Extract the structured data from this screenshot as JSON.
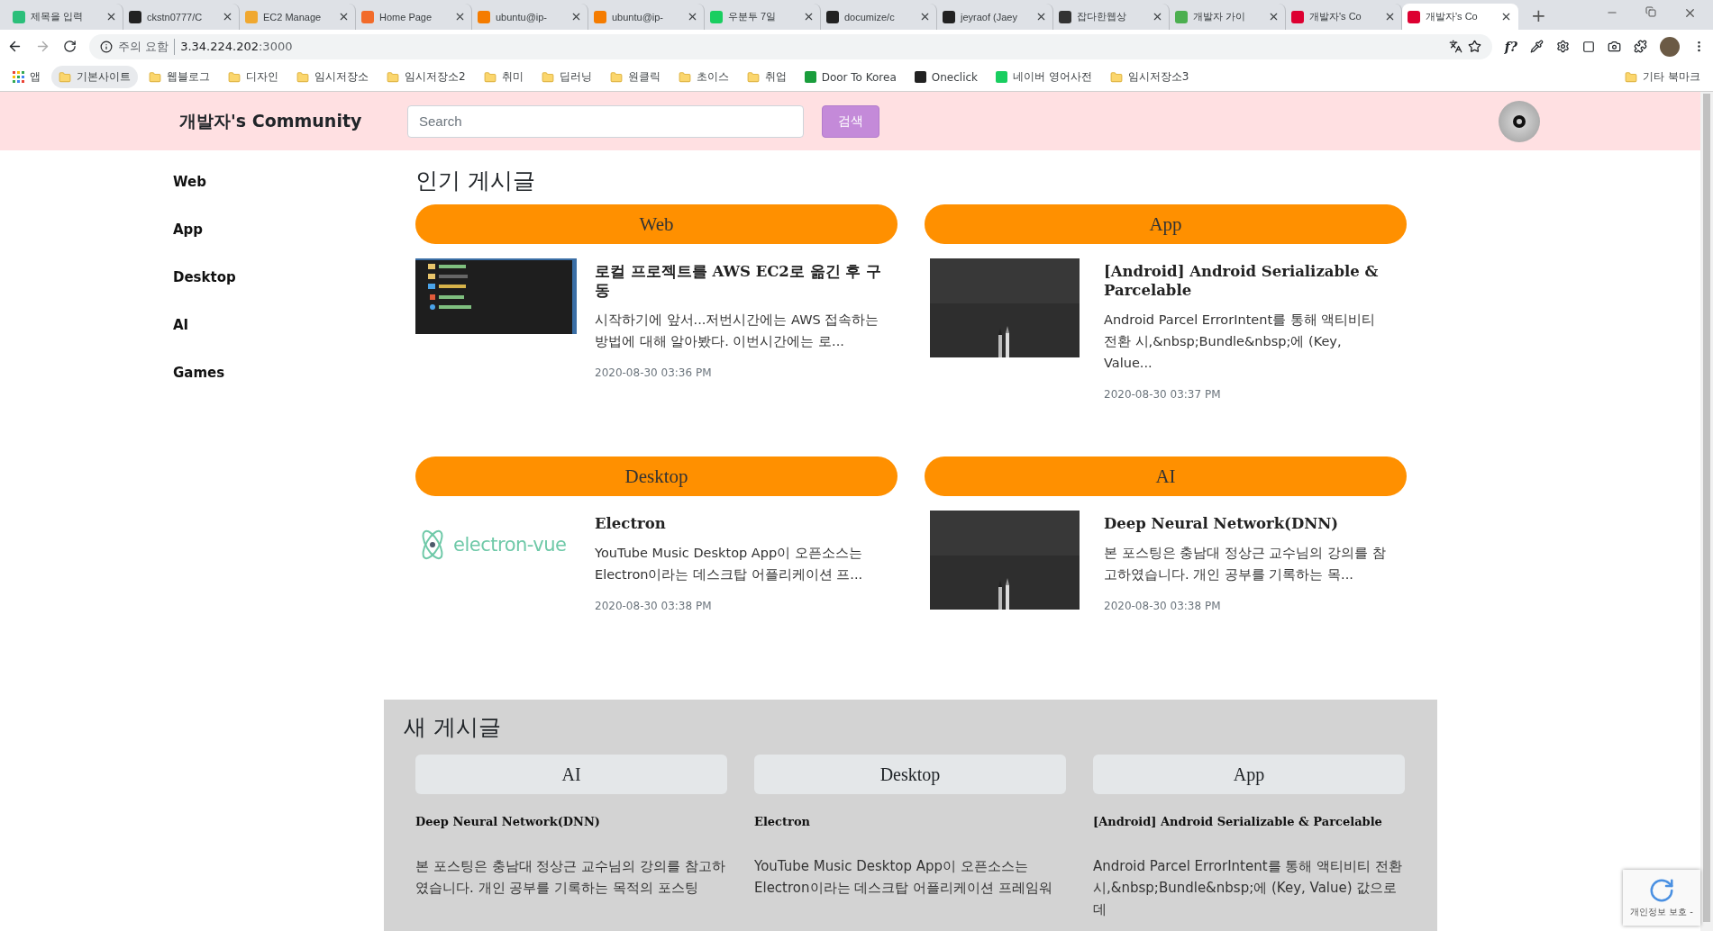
{
  "browser": {
    "tabs": [
      {
        "title": "제목을 입력",
        "color": "#2bbf7a",
        "selected": false
      },
      {
        "title": "ckstn0777/C",
        "color": "#222222",
        "selected": false
      },
      {
        "title": "EC2 Manage",
        "color": "#f0a830",
        "selected": false
      },
      {
        "title": "Home Page",
        "color": "#f26b2a",
        "selected": false
      },
      {
        "title": "ubuntu@ip-",
        "color": "#f57c00",
        "selected": false
      },
      {
        "title": "ubuntu@ip-",
        "color": "#f57c00",
        "selected": false
      },
      {
        "title": "우분투 7일",
        "color": "#19ce60",
        "selected": false
      },
      {
        "title": "documize/c",
        "color": "#222222",
        "selected": false
      },
      {
        "title": "jeyraof (Jaey",
        "color": "#222222",
        "selected": false
      },
      {
        "title": "잡다한웹상",
        "color": "#333333",
        "selected": false
      },
      {
        "title": "개발자 가이",
        "color": "#4caf50",
        "selected": false
      },
      {
        "title": "개발자's Co",
        "color": "#dd0031",
        "selected": false
      },
      {
        "title": "개발자's Co",
        "color": "#dd0031",
        "selected": true
      }
    ],
    "new_tab": "+",
    "address": {
      "warning": "주의 요함",
      "host": "3.34.224.202",
      "port": ":3000"
    },
    "extension_label": "f?",
    "bookmarks": [
      {
        "label": "앱",
        "kind": "apps",
        "selected": false
      },
      {
        "label": "기본사이트",
        "kind": "folder",
        "selected": true
      },
      {
        "label": "웹블로그",
        "kind": "folder",
        "selected": false
      },
      {
        "label": "디자인",
        "kind": "folder",
        "selected": false
      },
      {
        "label": "임시저장소",
        "kind": "folder",
        "selected": false
      },
      {
        "label": "임시저장소2",
        "kind": "folder",
        "selected": false
      },
      {
        "label": "취미",
        "kind": "folder",
        "selected": false
      },
      {
        "label": "딥러닝",
        "kind": "folder",
        "selected": false
      },
      {
        "label": "원클릭",
        "kind": "folder",
        "selected": false
      },
      {
        "label": "초이스",
        "kind": "folder",
        "selected": false
      },
      {
        "label": "취업",
        "kind": "folder",
        "selected": false
      },
      {
        "label": "Door To Korea",
        "kind": "site",
        "color": "#1a9d3c",
        "selected": false
      },
      {
        "label": "Oneclick",
        "kind": "site",
        "color": "#222222",
        "selected": false
      },
      {
        "label": "네이버 영어사전",
        "kind": "site",
        "color": "#19ce60",
        "selected": false
      },
      {
        "label": "임시저장소3",
        "kind": "folder",
        "selected": false
      }
    ],
    "other_bookmarks": "기타 북마크"
  },
  "header": {
    "brand": "개발자's Community",
    "search": {
      "placeholder": "Search"
    },
    "search_button": "검색"
  },
  "sidebar": {
    "items": [
      "Web",
      "App",
      "Desktop",
      "AI",
      "Games"
    ]
  },
  "popular": {
    "title": "인기 게시글",
    "groups": [
      {
        "category": "Web",
        "title": "로컬 프로젝트를 AWS EC2로 옮긴 후 구동",
        "excerpt": "시작하기에 앞서...저번시간에는 AWS 접속하는 방법에 대해 알아봤다. 이번시간에는 로...",
        "date": "2020-08-30 03:36 PM"
      },
      {
        "category": "App",
        "title": "[Android] Android Serializable & Parcelable",
        "excerpt": "Android Parcel ErrorIntent를 통해 액티비티 전환 시,&nbsp;Bundle&nbsp;에 (Key, Value...",
        "date": "2020-08-30 03:37 PM"
      },
      {
        "category": "Desktop",
        "thumb": {
          "kind": "logo",
          "text": "electron-vue"
        },
        "title": "Electron",
        "excerpt": "YouTube Music Desktop App이 오픈소스는 Electron이라는 데스크탑 어플리케이션 프...",
        "date": "2020-08-30 03:38 PM"
      },
      {
        "category": "AI",
        "title": "Deep Neural Network(DNN)",
        "excerpt": "본 포스팅은 충남대 정상근 교수님의 강의를 참고하였습니다. 개인 공부를 기록하는 목...",
        "date": "2020-08-30 03:38 PM"
      }
    ]
  },
  "recent": {
    "title": "새 게시글",
    "posts": [
      {
        "category": "AI",
        "title": "Deep Neural Network(DNN)",
        "excerpt": "본 포스팅은 충남대 정상근 교수님의 강의를 참고하였습니다. 개인 공부를 기록하는 목적의 포스팅"
      },
      {
        "category": "Desktop",
        "title": "Electron",
        "excerpt": "YouTube Music Desktop App이 오픈소스는 Electron이라는 데스크탑 어플리케이션 프레임워"
      },
      {
        "category": "App",
        "title": "[Android] Android Serializable & Parcelable",
        "excerpt": "Android Parcel ErrorIntent를 통해 액티비티 전환 시,&nbsp;Bundle&nbsp;에 (Key, Value) 값으로 데"
      }
    ]
  },
  "recaptcha": {
    "text": "개인정보 보호 -"
  }
}
